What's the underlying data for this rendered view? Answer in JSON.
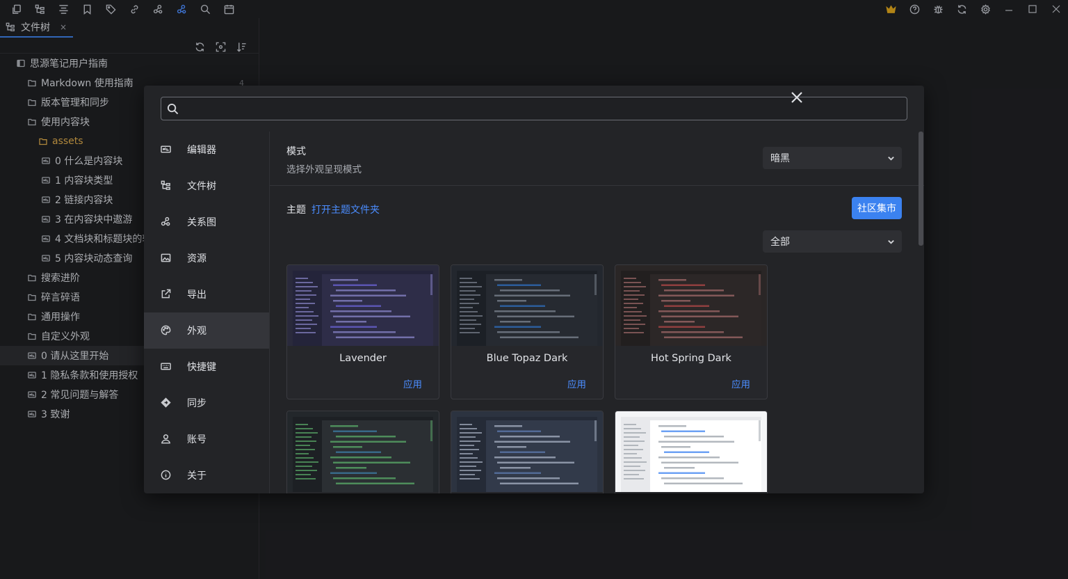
{
  "toolbar": {
    "left_icons": [
      "copy-icon",
      "file-tree-icon",
      "outline-icon",
      "bookmark-icon",
      "tag-icon",
      "backlink-icon",
      "graph-icon",
      "global-graph-icon",
      "search-icon",
      "calendar-icon"
    ],
    "right_icons": [
      "crown-icon",
      "help-icon",
      "bug-icon",
      "sync-icon",
      "settings-icon"
    ],
    "window_controls": [
      "minimize-icon",
      "maximize-icon",
      "close-icon"
    ]
  },
  "dock": {
    "tab_label": "文件树",
    "tab_close": "×",
    "tree": [
      {
        "label": "思源笔记用户指南",
        "type": "notebook",
        "indent": 24
      },
      {
        "label": "Markdown 使用指南",
        "type": "folder",
        "indent": 40,
        "count": "4"
      },
      {
        "label": "版本管理和同步",
        "type": "folder",
        "indent": 40
      },
      {
        "label": "使用内容块",
        "type": "folder",
        "indent": 40
      },
      {
        "label": "assets",
        "type": "assets",
        "indent": 56
      },
      {
        "label": "0 什么是内容块",
        "type": "doc",
        "indent": 60
      },
      {
        "label": "1 内容块类型",
        "type": "doc",
        "indent": 60
      },
      {
        "label": "2 链接内容块",
        "type": "doc",
        "indent": 60
      },
      {
        "label": "3 在内容块中遨游",
        "type": "doc",
        "indent": 60
      },
      {
        "label": "4 文档块和标题块的转",
        "type": "doc",
        "indent": 60
      },
      {
        "label": "5 内容块动态查询",
        "type": "doc",
        "indent": 60
      },
      {
        "label": "搜索进阶",
        "type": "folder",
        "indent": 40
      },
      {
        "label": "碎言碎语",
        "type": "folder",
        "indent": 40
      },
      {
        "label": "通用操作",
        "type": "folder",
        "indent": 40
      },
      {
        "label": "自定义外观",
        "type": "folder",
        "indent": 40
      },
      {
        "label": "0 请从这里开始",
        "type": "doc",
        "indent": 40,
        "selected": true
      },
      {
        "label": "1 隐私条款和使用授权",
        "type": "doc",
        "indent": 40
      },
      {
        "label": "2 常见问题与解答",
        "type": "doc",
        "indent": 40
      },
      {
        "label": "3 致谢",
        "type": "doc",
        "indent": 40
      }
    ]
  },
  "settings": {
    "search": {
      "value": "",
      "placeholder": ""
    },
    "nav": [
      {
        "label": "编辑器",
        "icon": "editor-icon"
      },
      {
        "label": "文件树",
        "icon": "file-tree-icon"
      },
      {
        "label": "关系图",
        "icon": "graph-icon"
      },
      {
        "label": "资源",
        "icon": "image-icon"
      },
      {
        "label": "导出",
        "icon": "export-icon"
      },
      {
        "label": "外观",
        "icon": "palette-icon",
        "active": true
      },
      {
        "label": "快捷键",
        "icon": "keyboard-icon"
      },
      {
        "label": "同步",
        "icon": "sync-icon"
      },
      {
        "label": "账号",
        "icon": "account-icon"
      },
      {
        "label": "关于",
        "icon": "info-icon"
      }
    ],
    "mode": {
      "title": "模式",
      "description": "选择外观呈现模式",
      "selected": "暗黑"
    },
    "theme": {
      "label": "主题",
      "open_folder_link": "打开主题文件夹",
      "market_button": "社区集市",
      "filter_selected": "全部"
    },
    "cards": [
      {
        "name": "Lavender",
        "apply": "应用",
        "palette": "lavender"
      },
      {
        "name": "Blue Topaz Dark",
        "apply": "应用",
        "palette": "topaz"
      },
      {
        "name": "Hot Spring Dark",
        "apply": "应用",
        "palette": "hotspring"
      },
      {
        "name": "",
        "apply": "",
        "palette": "darkgreen"
      },
      {
        "name": "",
        "apply": "",
        "palette": "starry"
      },
      {
        "name": "",
        "apply": "",
        "palette": "light"
      }
    ]
  },
  "colors": {
    "accent": "#4b8dff",
    "market_button": "#3b82f0",
    "folder_gold": "#d7a64a"
  }
}
